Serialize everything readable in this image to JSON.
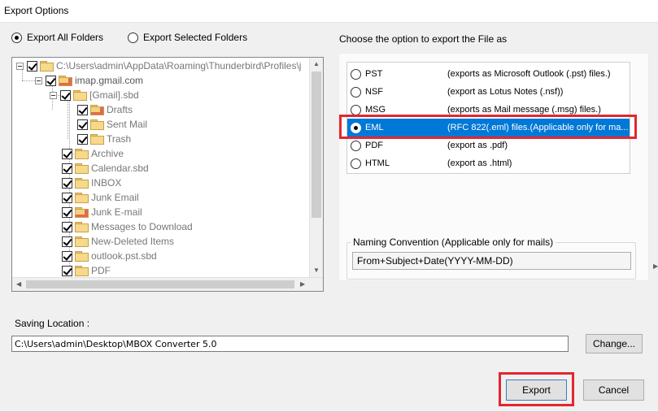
{
  "window": {
    "title": "Export Options"
  },
  "folder_mode": {
    "all_label": "Export All Folders",
    "selected_label": "Export Selected Folders",
    "selected": "all"
  },
  "tree": {
    "root": "C:\\Users\\admin\\AppData\\Roaming\\Thunderbird\\Profiles\\j",
    "account": "imap.gmail.com",
    "gmail": "[Gmail].sbd",
    "gmail_children": [
      "Drafts",
      "Sent Mail",
      "Trash"
    ],
    "folders": [
      "Archive",
      "Calendar.sbd",
      "INBOX",
      "Junk Email",
      "Junk E-mail",
      "Messages to Download",
      "New-Deleted Items",
      "outlook.pst.sbd",
      "PDF"
    ]
  },
  "export_as": {
    "heading": "Choose the option to export the File as",
    "options": [
      {
        "name": "PST",
        "desc": "(exports as Microsoft Outlook (.pst) files.)"
      },
      {
        "name": "NSF",
        "desc": "(export as Lotus Notes (.nsf))"
      },
      {
        "name": "MSG",
        "desc": "(exports as Mail message (.msg) files.)"
      },
      {
        "name": "EML",
        "desc": "(RFC 822(.eml) files.(Applicable only for ma..."
      },
      {
        "name": "PDF",
        "desc": "(export as .pdf)"
      },
      {
        "name": "HTML",
        "desc": "(export as .html)"
      }
    ],
    "selected": "EML"
  },
  "naming": {
    "legend": "Naming Convention (Applicable only for mails)",
    "value": "From+Subject+Date(YYYY-MM-DD)"
  },
  "saving": {
    "label": "Saving Location :",
    "path": "C:\\Users\\admin\\Desktop\\MBOX Converter 5.0",
    "change_label": "Change..."
  },
  "actions": {
    "export_label": "Export",
    "cancel_label": "Cancel"
  },
  "colors": {
    "selection": "#0078d7",
    "highlight": "#e3262f"
  }
}
